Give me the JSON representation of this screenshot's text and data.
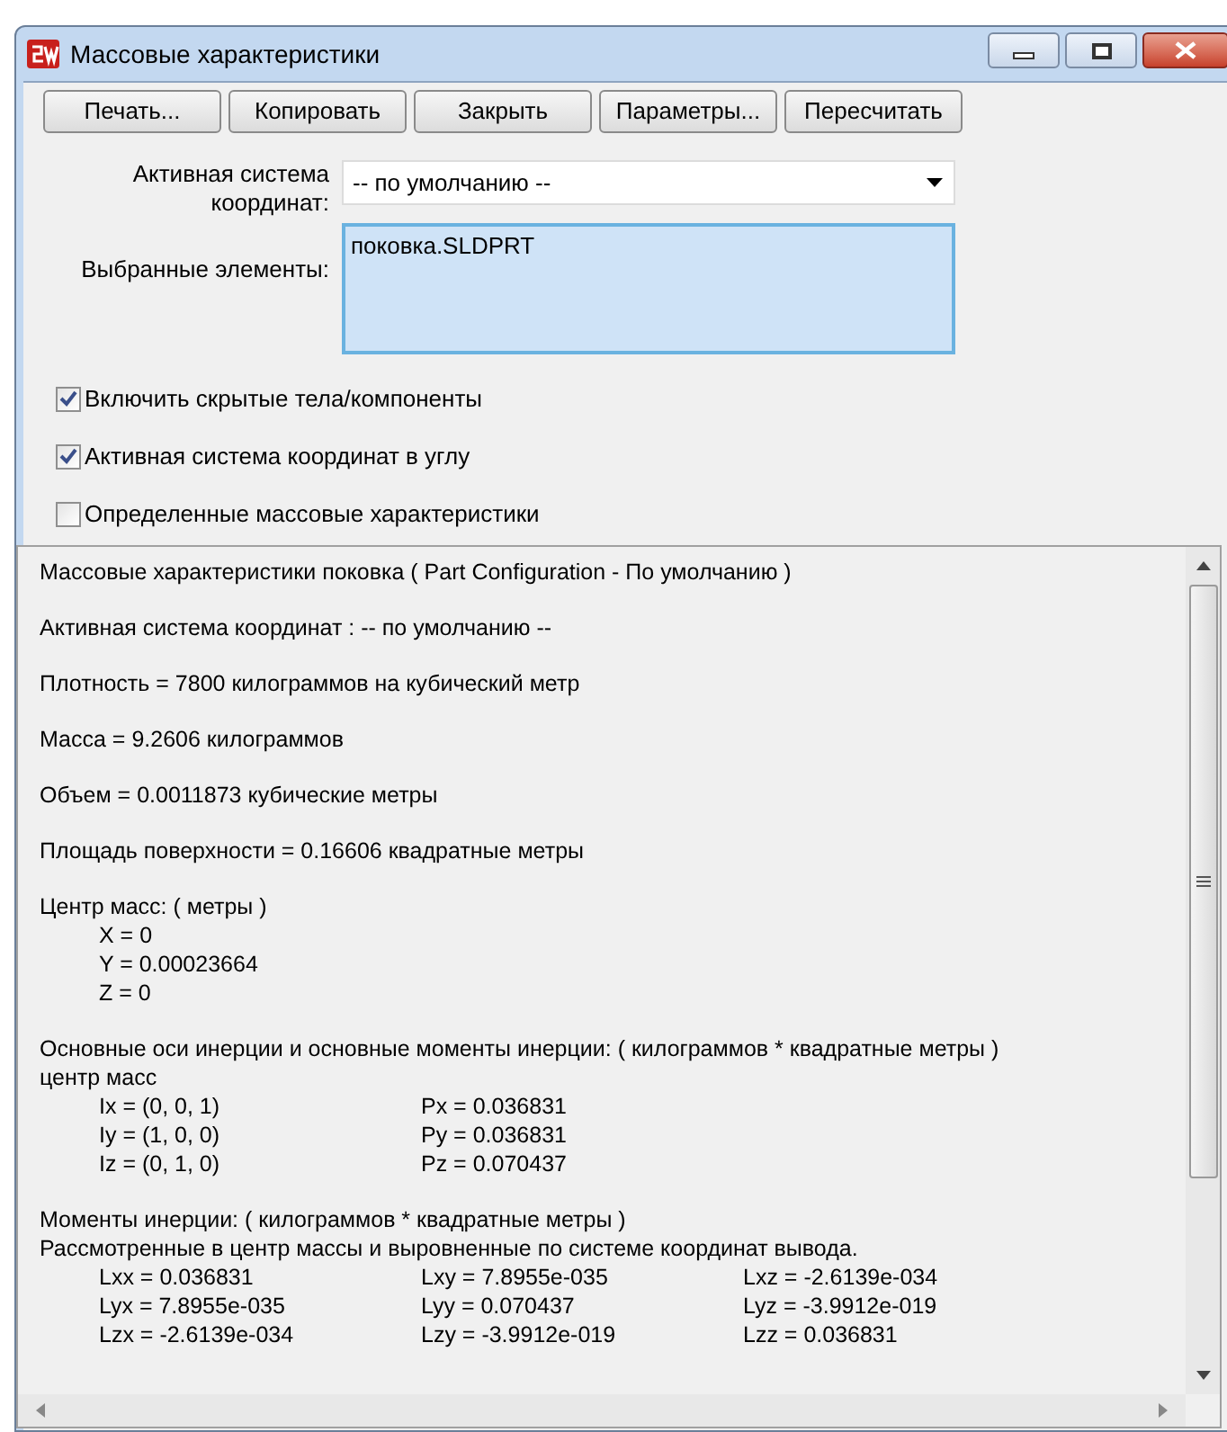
{
  "window": {
    "title": "Массовые характеристики"
  },
  "buttons": [
    "Печать...",
    "Копировать",
    "Закрыть",
    "Параметры...",
    "Пересчитать"
  ],
  "coord_system": {
    "label": "Активная система координат:",
    "value": "-- по умолчанию --"
  },
  "selected_items": {
    "label": "Выбранные элементы:",
    "items": [
      "поковка.SLDPRT"
    ]
  },
  "options": [
    {
      "label": "Включить скрытые тела/компоненты",
      "checked": true
    },
    {
      "label": "Активная система координат в углу",
      "checked": true
    },
    {
      "label": "Определенные массовые характеристики",
      "checked": false
    }
  ],
  "report": [
    {
      "lines": [
        {
          "kind": "text",
          "text": "Массовые характеристики поковка ( Part Configuration - По умолчанию )"
        }
      ]
    },
    {
      "lines": [
        {
          "kind": "text",
          "text": "Активная система координат : -- по умолчанию --"
        }
      ]
    },
    {
      "lines": [
        {
          "kind": "text",
          "text": "Плотность = 7800 килограммов на кубический метр"
        }
      ]
    },
    {
      "lines": [
        {
          "kind": "text",
          "text": "Масса = 9.2606 килограммов"
        }
      ]
    },
    {
      "lines": [
        {
          "kind": "text",
          "text": "Объем = 0.0011873 кубические метры"
        }
      ]
    },
    {
      "lines": [
        {
          "kind": "text",
          "text": "Площадь поверхности = 0.16606 квадратные метры"
        }
      ]
    },
    {
      "lines": [
        {
          "kind": "text",
          "text": "Центр масс: ( метры )"
        },
        {
          "kind": "row",
          "cells": [
            "X = 0"
          ]
        },
        {
          "kind": "row",
          "cells": [
            "Y = 0.00023664"
          ]
        },
        {
          "kind": "row",
          "cells": [
            "Z = 0"
          ]
        }
      ]
    },
    {
      "lines": [
        {
          "kind": "text",
          "text": "Основные оси инерции и основные моменты инерции: ( килограммов * квадратные метры )"
        },
        {
          "kind": "text",
          "text": "центр масс"
        },
        {
          "kind": "row",
          "cells": [
            "Ix = (0, 0, 1)",
            "Px = 0.036831"
          ]
        },
        {
          "kind": "row",
          "cells": [
            "Iy = (1, 0, 0)",
            "Py = 0.036831"
          ]
        },
        {
          "kind": "row",
          "cells": [
            "Iz = (0, 1, 0)",
            "Pz = 0.070437"
          ]
        }
      ]
    },
    {
      "lines": [
        {
          "kind": "text",
          "text": "Моменты инерции: ( килограммов * квадратные метры )"
        },
        {
          "kind": "text",
          "text": "Рассмотренные в центр массы и выровненные по системе координат вывода."
        },
        {
          "kind": "row",
          "cells": [
            "Lxx = 0.036831",
            "Lxy = 7.8955e-035",
            "Lxz = -2.6139e-034"
          ]
        },
        {
          "kind": "row",
          "cells": [
            "Lyx = 7.8955e-035",
            "Lyy = 0.070437",
            "Lyz = -3.9912e-019"
          ]
        },
        {
          "kind": "row",
          "cells": [
            "Lzx = -2.6139e-034",
            "Lzy = -3.9912e-019",
            "Lzz = 0.036831"
          ]
        }
      ]
    }
  ]
}
